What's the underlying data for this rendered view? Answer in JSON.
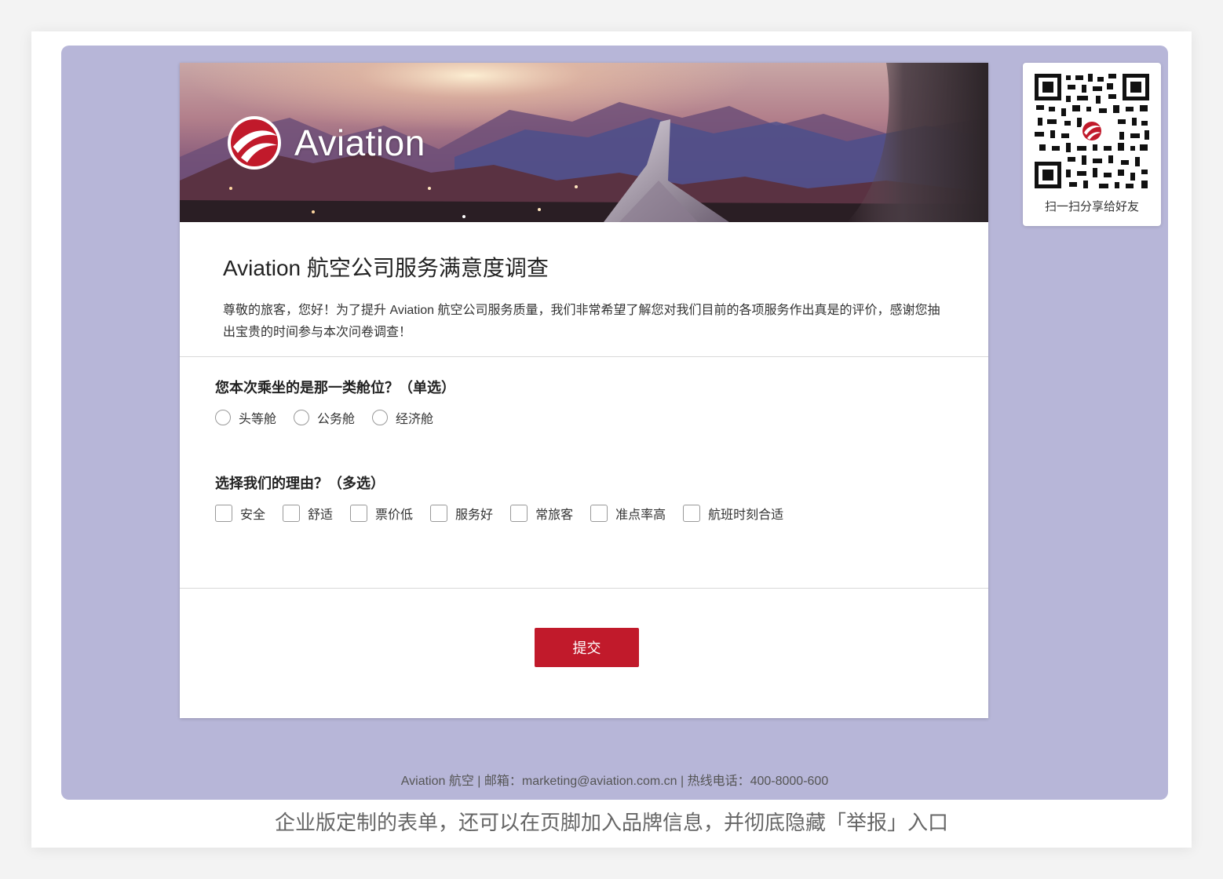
{
  "banner": {
    "brand_name": "Aviation"
  },
  "survey": {
    "title": "Aviation 航空公司服务满意度调查",
    "description": "尊敬的旅客，您好！为了提升 Aviation 航空公司服务质量，我们非常希望了解您对我们目前的各项服务作出真是的评价，感谢您抽出宝贵的时间参与本次问卷调查！"
  },
  "questions": [
    {
      "title": "您本次乘坐的是那一类舱位？（单选）",
      "type": "radio",
      "options": [
        "头等舱",
        "公务舱",
        "经济舱"
      ]
    },
    {
      "title": "选择我们的理由？（多选）",
      "type": "checkbox",
      "options": [
        "安全",
        "舒适",
        "票价低",
        "服务好",
        "常旅客",
        "准点率高",
        "航班时刻合适"
      ]
    }
  ],
  "submit_label": "提交",
  "qr": {
    "label": "扫一扫分享给好友"
  },
  "footer": "Aviation 航空 | 邮箱：marketing@aviation.com.cn | 热线电话：400-8000-600",
  "caption": "企业版定制的表单，还可以在页脚加入品牌信息，并彻底隐藏「举报」入口",
  "colors": {
    "page_bg": "#b7b6d8",
    "accent": "#c11a2b",
    "form_bg": "#ffffff"
  }
}
